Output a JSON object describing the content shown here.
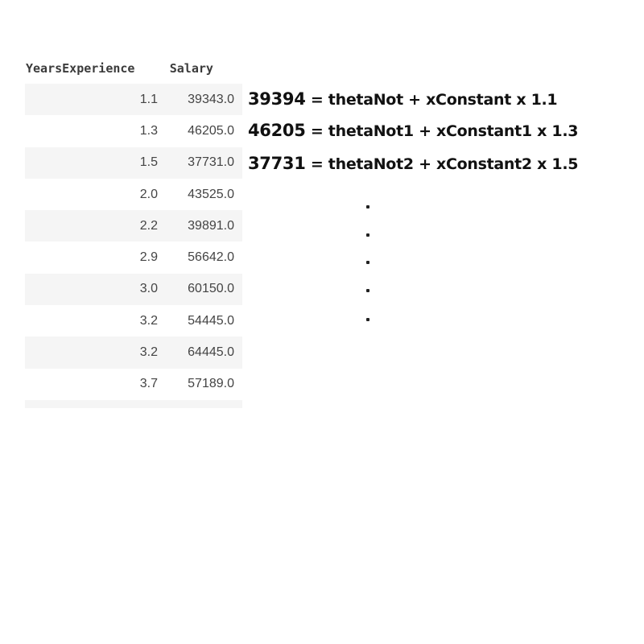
{
  "table": {
    "headers": [
      "YearsExperience",
      "Salary"
    ],
    "rows": [
      [
        "1.1",
        "39343.0"
      ],
      [
        "1.3",
        "46205.0"
      ],
      [
        "1.5",
        "37731.0"
      ],
      [
        "2.0",
        "43525.0"
      ],
      [
        "2.2",
        "39891.0"
      ],
      [
        "2.9",
        "56642.0"
      ],
      [
        "3.0",
        "60150.0"
      ],
      [
        "3.2",
        "54445.0"
      ],
      [
        "3.2",
        "64445.0"
      ],
      [
        "3.7",
        "57189.0"
      ]
    ]
  },
  "annotations": {
    "equations": [
      {
        "number": "39394",
        "rest": " = thetaNot + xConstant x 1.1"
      },
      {
        "number": "46205",
        "rest": " = thetaNot1 + xConstant1 x 1.3"
      },
      {
        "number": "37731",
        "rest": " = thetaNot2 + xConstant2 x 1.5"
      }
    ],
    "ellipsis_dot_count": 5
  }
}
